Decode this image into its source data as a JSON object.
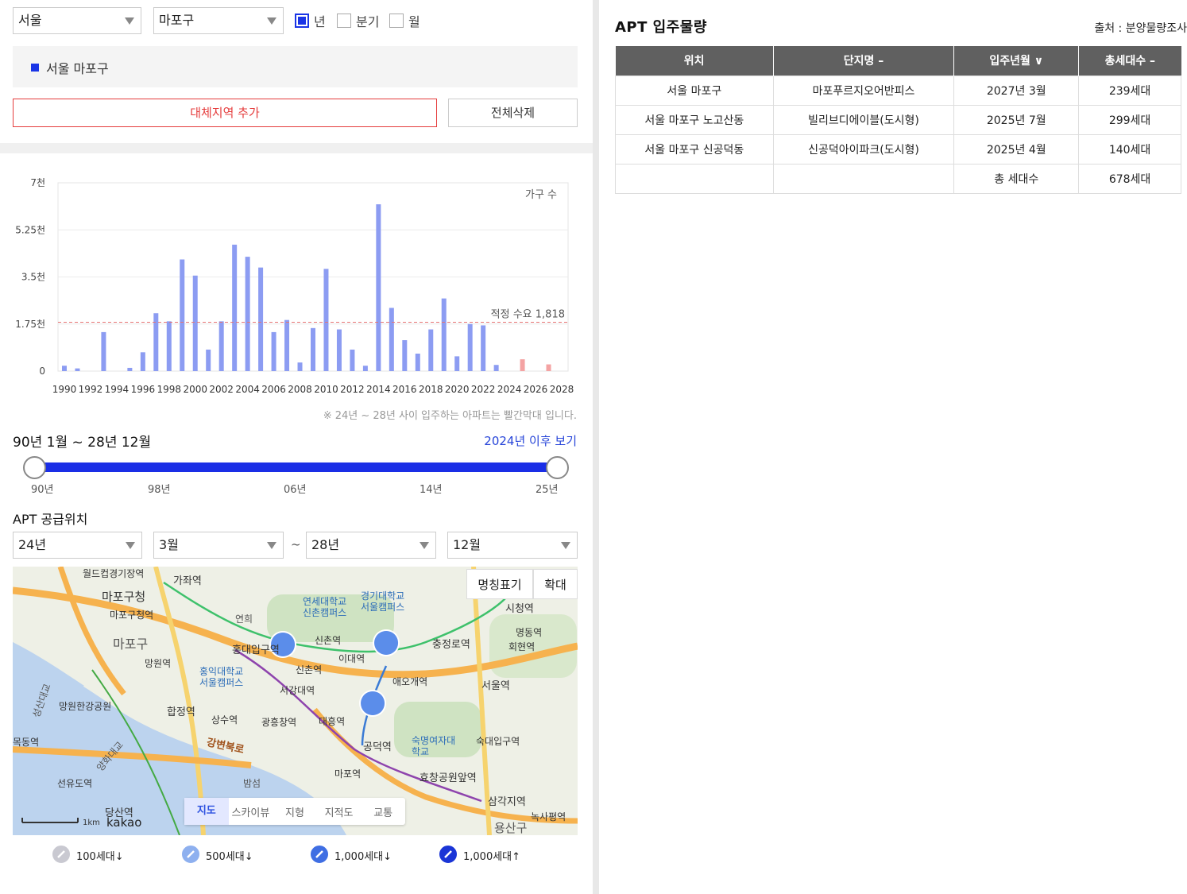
{
  "filters": {
    "city": "서울",
    "district": "마포구",
    "period_options": [
      {
        "label": "년",
        "checked": true
      },
      {
        "label": "분기",
        "checked": false
      },
      {
        "label": "월",
        "checked": false
      }
    ]
  },
  "region_tag": "서울 마포구",
  "buttons": {
    "add_region": "대체지역 추가",
    "delete_all": "전체삭제"
  },
  "chart_data": {
    "type": "bar",
    "y_unit_label": "가구 수",
    "yticks": [
      "0",
      "1.75천",
      "3.5천",
      "5.25천",
      "7천"
    ],
    "ylim": [
      0,
      7000
    ],
    "xticks": [
      "1990",
      "1992",
      "1994",
      "1996",
      "1998",
      "2000",
      "2002",
      "2004",
      "2006",
      "2008",
      "2010",
      "2012",
      "2014",
      "2016",
      "2018",
      "2020",
      "2022",
      "2024",
      "2026",
      "2028"
    ],
    "x": [
      1990,
      1991,
      1992,
      1993,
      1994,
      1995,
      1996,
      1997,
      1998,
      1999,
      2000,
      2001,
      2002,
      2003,
      2004,
      2005,
      2006,
      2007,
      2008,
      2009,
      2010,
      2011,
      2012,
      2013,
      2014,
      2015,
      2016,
      2017,
      2018,
      2019,
      2020,
      2021,
      2022,
      2023,
      2024,
      2025,
      2026,
      2027,
      2028
    ],
    "values": [
      200,
      100,
      0,
      1450,
      0,
      120,
      700,
      2150,
      1850,
      4150,
      3550,
      800,
      1850,
      4700,
      4250,
      3850,
      1450,
      1900,
      320,
      1600,
      3800,
      1550,
      800,
      200,
      6200,
      2350,
      1150,
      650,
      1550,
      2700,
      550,
      1750,
      1700,
      230,
      0,
      440,
      0,
      250,
      0
    ],
    "forecast_from": 2024,
    "reference_line": {
      "label": "적정 수요",
      "value": 1818,
      "value_text": "1,818"
    },
    "grid": true,
    "colors": {
      "actual": "#8c9cf2",
      "forecast": "#f4a3a3",
      "reference": "#e57373"
    }
  },
  "chart_note": "※ 24년 ~ 28년 사이 입주하는 아파트는 빨간막대 입니다.",
  "range": {
    "title": "90년 1월 ~ 28년 12월",
    "link": "2024년 이후 보기",
    "tick_labels": [
      "90년",
      "98년",
      "06년",
      "14년",
      "25년"
    ]
  },
  "supply": {
    "title": "APT 공급위치",
    "from_year": "24년",
    "from_month": "3월",
    "tilde": "~",
    "to_year": "28년",
    "to_month": "12월"
  },
  "map": {
    "label_btn": "명칭표기",
    "zoom_btn": "확대",
    "tabs": [
      "지도",
      "스카이뷰",
      "지형",
      "지적도",
      "교통"
    ],
    "active_tab": "지도",
    "scale": "1km",
    "brand": "kakao",
    "labels": [
      "월드컵경기장역",
      "가좌역",
      "마포구청",
      "마포구청역",
      "마포구",
      "연세대학교 신촌캠퍼스",
      "경기대학교 서울캠퍼스",
      "시청역",
      "연희",
      "신촌역",
      "홍대입구역",
      "이대역",
      "충정로역",
      "명동역",
      "회현역",
      "망원역",
      "홍익대학교 서울캠퍼스",
      "신촌역",
      "서강대역",
      "애오개역",
      "숙명여자대학교",
      "서울역",
      "합정역",
      "망원한강공원",
      "상수역",
      "광흥창역",
      "대흥역",
      "공덕역",
      "숙대입구역",
      "강변북로",
      "마포역",
      "효창공원앞역",
      "선유도역",
      "당산역",
      "삼각지역",
      "녹사평역",
      "용산구",
      "밤섬",
      "양화대교",
      "성산대교",
      "목동역"
    ]
  },
  "legend": [
    "100세대↓",
    "500세대↓",
    "1,000세대↓",
    "1,000세대↑"
  ],
  "right": {
    "title": "APT 입주물량",
    "source": "출처 : 분양물량조사",
    "columns": [
      "위치",
      "단지명 –",
      "입주년월 ∨",
      "총세대수 –"
    ],
    "rows": [
      [
        "서울 마포구",
        "마포푸르지오어반피스",
        "2027년 3월",
        "239세대"
      ],
      [
        "서울 마포구 노고산동",
        "빌리브디에이블(도시형)",
        "2025년 7월",
        "299세대"
      ],
      [
        "서울 마포구 신공덕동",
        "신공덕아이파크(도시형)",
        "2025년 4월",
        "140세대"
      ],
      [
        "",
        "",
        "총 세대수",
        "678세대"
      ]
    ]
  }
}
